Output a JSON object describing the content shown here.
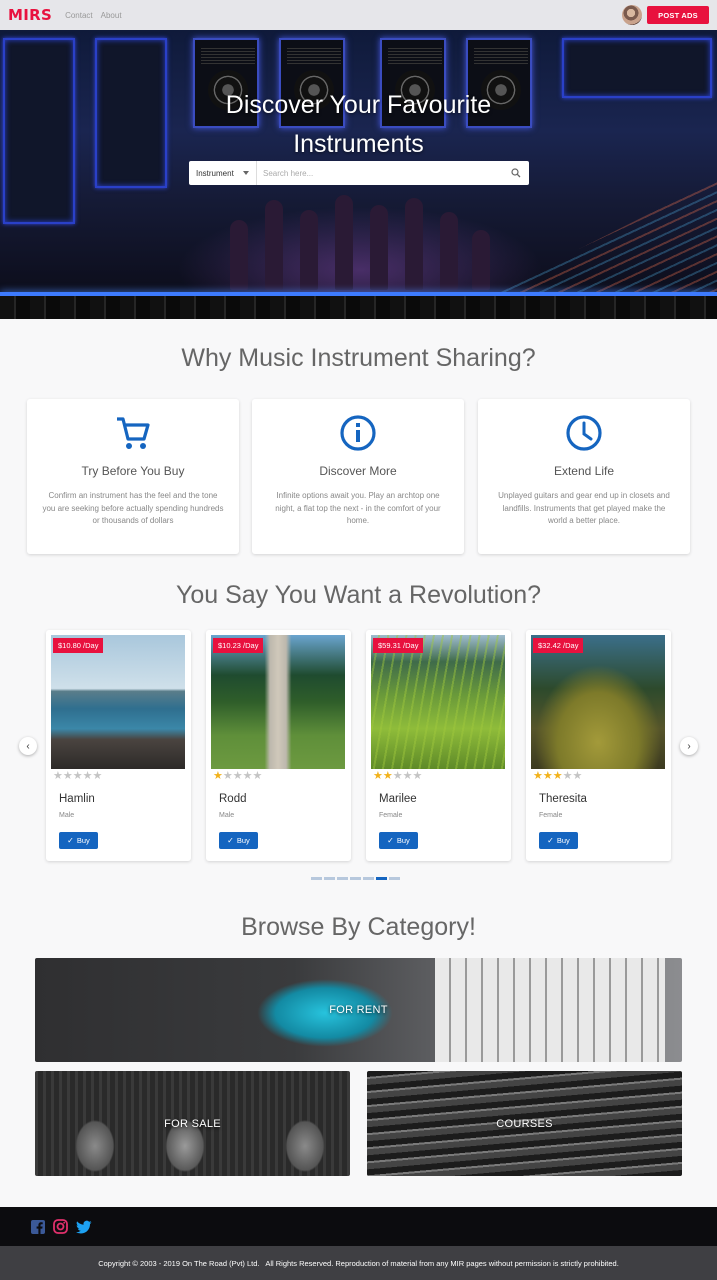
{
  "nav": {
    "brand": "MIRS",
    "links": [
      "Contact",
      "About"
    ],
    "post_ads_label": "POST ADS"
  },
  "hero": {
    "title_line1": "Discover Your Favourite",
    "title_line2": "Instruments",
    "search": {
      "category_value": "Instrument",
      "placeholder": "Search here..."
    }
  },
  "why": {
    "title": "Why Music Instrument Sharing?",
    "features": [
      {
        "icon": "cart-icon",
        "title": "Try Before You Buy",
        "description": "Confirm an instrument has the feel and the tone you are seeking before actually spending hundreds or thousands of dollars"
      },
      {
        "icon": "info-icon",
        "title": "Discover More",
        "description": "Infinite options await you. Play an archtop one night, a flat top the next - in the comfort of your home."
      },
      {
        "icon": "clock-icon",
        "title": "Extend Life",
        "description": "Unplayed guitars and gear end up in closets and landfills. Instruments that get played make the world a better place."
      }
    ]
  },
  "revolution": {
    "title": "You Say You Want a Revolution?",
    "cards": [
      {
        "price": "$10.80 /Day",
        "rating": 0,
        "name": "Hamlin",
        "gender": "Male",
        "buy": "Buy",
        "photo": "sea"
      },
      {
        "price": "$10.23 /Day",
        "rating": 1,
        "name": "Rodd",
        "gender": "Male",
        "buy": "Buy",
        "photo": "path"
      },
      {
        "price": "$59.31 /Day",
        "rating": 2,
        "name": "Marilee",
        "gender": "Female",
        "buy": "Buy",
        "photo": "grass"
      },
      {
        "price": "$32.42 /Day",
        "rating": 3,
        "name": "Theresita",
        "gender": "Female",
        "buy": "Buy",
        "photo": "moss"
      }
    ],
    "active_dot": 5,
    "dot_count": 7
  },
  "categories": {
    "title": "Browse By Category!",
    "items": [
      "FOR RENT",
      "FOR SALE",
      "COURSES"
    ]
  },
  "footer": {
    "social_icons": [
      "facebook-icon",
      "instagram-icon",
      "twitter-icon"
    ],
    "copyright": "Copyright © 2003 - 2019 On The Road (Pvt) Ltd.   All Rights Reserved. Reproduction of material from any MIR pages without permission is strictly prohibited."
  },
  "colors": {
    "brand_red": "#e8113e",
    "primary_blue": "#1565c0",
    "star_gold": "#f2b21b"
  }
}
